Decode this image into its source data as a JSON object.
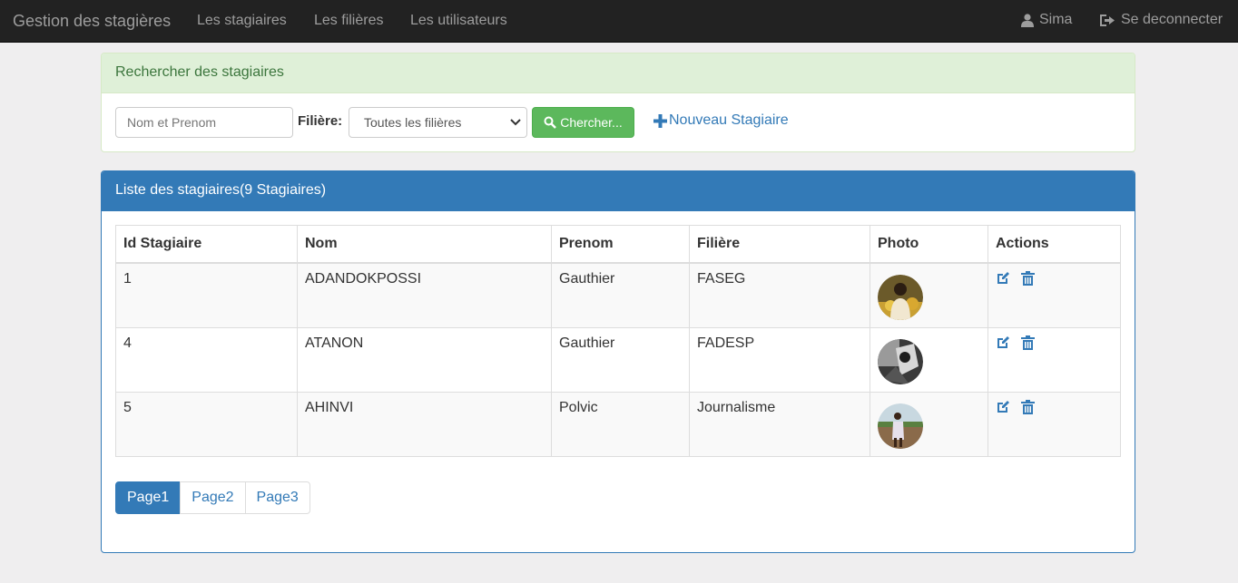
{
  "navbar": {
    "brand": "Gestion des stagières",
    "links": [
      "Les stagiaires",
      "Les filières",
      "Les utilisateurs"
    ],
    "user": "Sima",
    "logout": "Se deconnecter"
  },
  "search_panel": {
    "title": "Rechercher des stagiaires",
    "input_placeholder": "Nom et Prenom",
    "filiere_label": "Filière:",
    "select_value": "Toutes les filières",
    "search_button": "Chercher...",
    "new_link": "Nouveau Stagiaire"
  },
  "list_panel": {
    "title": "Liste des stagiaires(9 Stagiaires)",
    "columns": [
      "Id Stagiaire",
      "Nom",
      "Prenom",
      "Filière",
      "Photo",
      "Actions"
    ],
    "rows": [
      {
        "id": "1",
        "nom": "ADANDOKPOSSI",
        "prenom": "Gauthier",
        "filiere": "FASEG"
      },
      {
        "id": "4",
        "nom": "ATANON",
        "prenom": "Gauthier",
        "filiere": "FADESP"
      },
      {
        "id": "5",
        "nom": "AHINVI",
        "prenom": "Polvic",
        "filiere": "Journalisme"
      }
    ]
  },
  "pagination": {
    "pages": [
      "Page1",
      "Page2",
      "Page3"
    ],
    "active_index": 0
  },
  "icons": {
    "user": "user-icon",
    "logout": "logout-icon",
    "search": "search-icon",
    "plus": "plus-icon",
    "edit": "edit-icon",
    "delete": "trash-icon"
  },
  "colors": {
    "primary": "#337ab7",
    "success": "#5cb85c",
    "navbar": "#222222"
  }
}
